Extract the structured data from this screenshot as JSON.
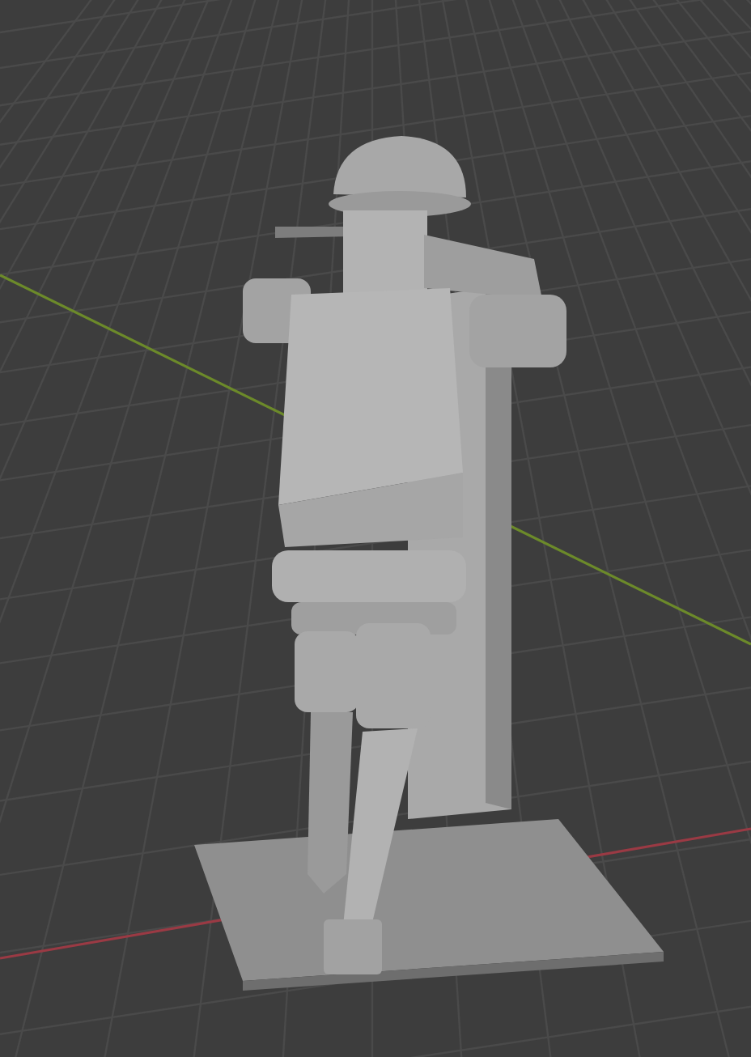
{
  "viewport": {
    "x_axis_visible": true,
    "y_axis_visible": true
  }
}
